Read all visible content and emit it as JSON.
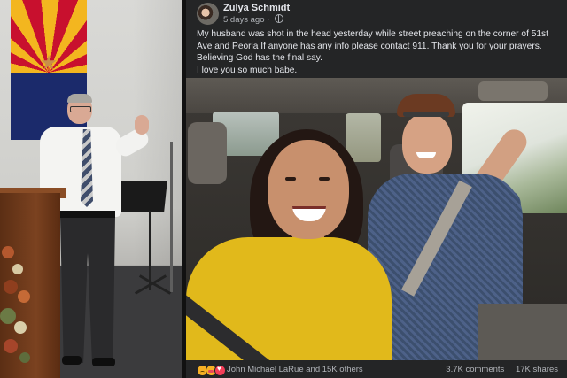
{
  "post": {
    "author": "Zulya Schmidt",
    "time": "5 days ago",
    "separator": "·",
    "text_line_1": "My husband was shot in the head yesterday while street preaching on the corner of 51st Ave and Peoria If anyone has any info please contact 911. Thank you for your prayers. Believing God has the final say.",
    "text_line_2": "I love you so much babe.",
    "reaction_summary": "John Michael LaRue and 15K others",
    "comments": "3.7K comments",
    "shares": "17K shares"
  },
  "icons": {
    "visibility": "globe-icon",
    "reactions": [
      "sad-reaction-icon",
      "care-reaction-icon",
      "love-reaction-icon"
    ]
  },
  "colors": {
    "post_background": "#242526",
    "primary_text": "#e4e6eb",
    "secondary_text": "#b0b3b8"
  }
}
